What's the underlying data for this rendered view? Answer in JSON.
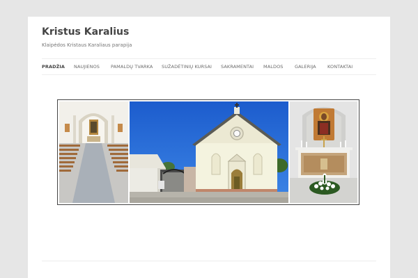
{
  "site": {
    "title": "Kristus Karalius",
    "description": "Klaipėdos Kristaus Karaliaus parapija"
  },
  "nav": {
    "items": [
      {
        "label": "PRADŽIA",
        "active": true
      },
      {
        "label": "NAUJIENOS"
      },
      {
        "label": "PAMALDŲ TVARKA"
      },
      {
        "label": "SUŽADĖTINIŲ KURSAI"
      },
      {
        "label": "SAKRAMENTAI"
      },
      {
        "label": "MALDOS"
      },
      {
        "label": "GALERIJA"
      },
      {
        "label": "KONTAKTAI"
      }
    ]
  },
  "colors": {
    "page_background": "#e6e6e6",
    "content_background": "#ffffff",
    "title_text": "#444444",
    "nav_text": "#6a6a6a",
    "sky": "#1f66d6",
    "church_wall": "#f4f3df"
  },
  "banner": {
    "panels": [
      {
        "subject": "church-interior-nave"
      },
      {
        "subject": "church-exterior-facade"
      },
      {
        "subject": "church-altar"
      }
    ]
  }
}
